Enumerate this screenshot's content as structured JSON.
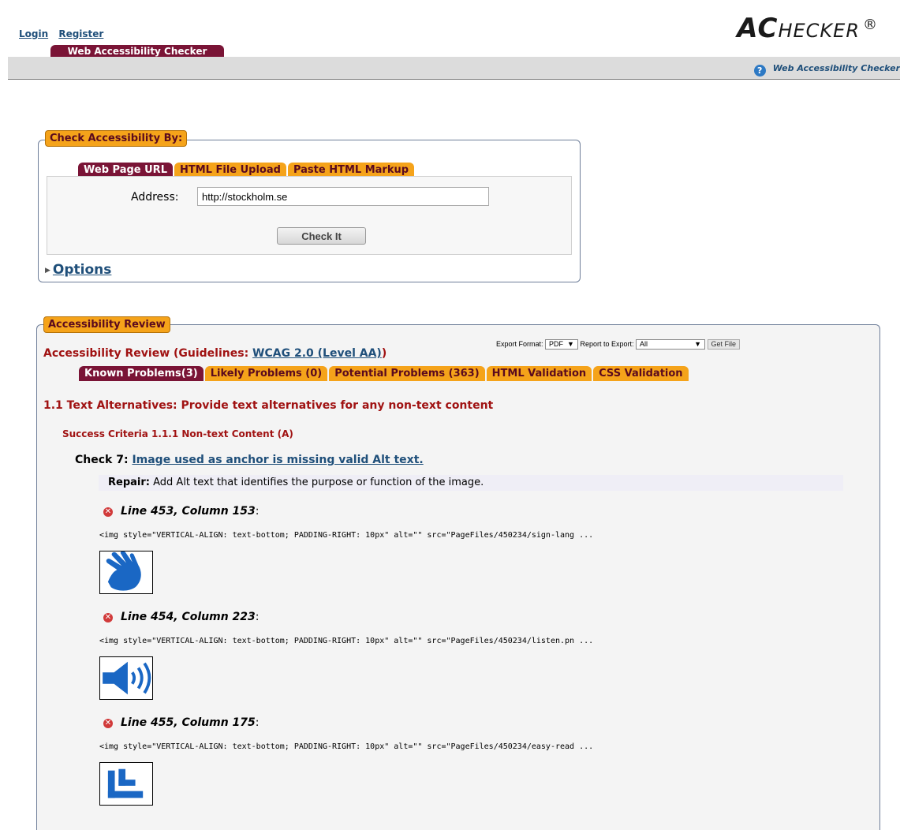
{
  "header": {
    "login": "Login",
    "register": "Register",
    "site_tab": "Web Accessibility Checker",
    "logo_big": "AC",
    "logo_rest": "HECKER",
    "logo_mark": "®",
    "help_text": "Web Accessibility Checker"
  },
  "check": {
    "legend": "Check Accessibility By:",
    "tabs": [
      "Web Page URL",
      "HTML File Upload",
      "Paste HTML Markup"
    ],
    "address_label": "Address:",
    "address_value": "http://stockholm.se",
    "check_button": "Check It",
    "options": "Options"
  },
  "review": {
    "legend": "Accessibility Review",
    "export_format_label": "Export Format:",
    "export_format_value": "PDF",
    "report_label": "Report to Export:",
    "report_value": "All",
    "get_file": "Get File",
    "title_prefix": "Accessibility Review (Guidelines: ",
    "title_link": "WCAG 2.0 (Level AA)",
    "title_suffix": ")",
    "tabs": [
      "Known Problems(3)",
      "Likely Problems (0)",
      "Potential Problems (363)",
      "HTML Validation",
      "CSS Validation"
    ],
    "guideline": "1.1 Text Alternatives: Provide text alternatives for any non-text content",
    "criteria": "Success Criteria 1.1.1 Non-text Content (A)",
    "check_label": "Check 7:",
    "check_link": "Image used as anchor is missing valid Alt text.",
    "repair_label": "Repair:",
    "repair_text": "Add Alt text that identifies the purpose or function of the image.",
    "problems": [
      {
        "location": "Line 453, Column 153",
        "code": "<img style=\"VERTICAL-ALIGN: text-bottom; PADDING-RIGHT: 10px\" alt=\"\" src=\"PageFiles/450234/sign-lang ...",
        "icon": "hand-icon"
      },
      {
        "location": "Line 454, Column 223",
        "code": "<img style=\"VERTICAL-ALIGN: text-bottom; PADDING-RIGHT: 10px\" alt=\"\" src=\"PageFiles/450234/listen.pn ...",
        "icon": "speaker-icon"
      },
      {
        "location": "Line 455, Column 175",
        "code": "<img style=\"VERTICAL-ALIGN: text-bottom; PADDING-RIGHT: 10px\" alt=\"\" src=\"PageFiles/450234/easy-read ...",
        "icon": "easy-read-icon"
      }
    ]
  },
  "colors": {
    "maroon": "#7a1436",
    "orange": "#f5a31a",
    "link": "#1f4f7a",
    "error_red": "#a01212"
  }
}
